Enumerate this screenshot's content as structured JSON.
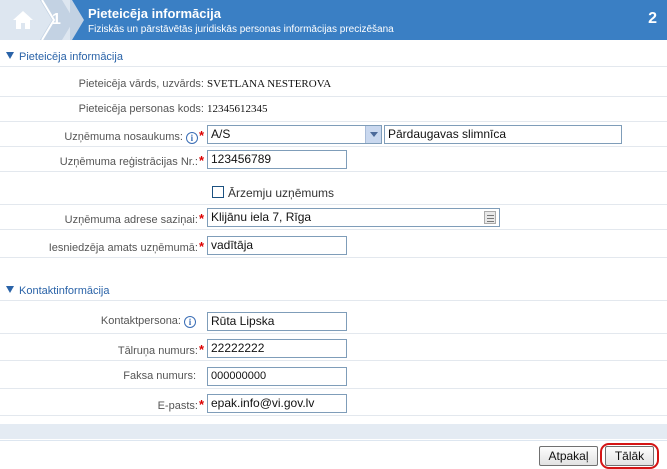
{
  "wizard": {
    "step_prev": "1",
    "title": "Pieteicēja informācija",
    "subtitle": "Fiziskās un pārstāvētās juridiskās personas informācijas precizēšana",
    "step_current": "2"
  },
  "applicant_section": {
    "heading": "Pieteicēja informācija",
    "name_label": "Pieteicēja vārds, uzvārds:",
    "name_value": "SVETLANA NESTEROVA",
    "code_label": "Pieteicēja personas kods:",
    "code_value": "12345612345",
    "company_name_label": "Uzņēmuma nosaukums:",
    "company_type_value": "A/S",
    "company_name_value": "Pārdaugavas slimnīca",
    "reg_no_label": "Uzņēmuma reģistrācijas Nr.:",
    "reg_no_value": "123456789",
    "foreign_label": "Ārzemju uzņēmums",
    "address_label": "Uzņēmuma adrese saziņai:",
    "address_value": "Klijānu iela 7, Rīga",
    "position_label": "Iesniedzēja amats uzņēmumā:",
    "position_value": "vadītāja"
  },
  "contact_section": {
    "heading": "Kontaktinformācija",
    "person_label": "Kontaktpersona:",
    "person_value": "Rūta Lipska",
    "phone_label": "Tālruņa numurs:",
    "phone_value": "22222222",
    "fax_label": "Faksa numurs:",
    "fax_value": "000000000",
    "email_label": "E-pasts:",
    "email_value": "epak.info@vi.gov.lv"
  },
  "buttons": {
    "back": "Atpakaļ",
    "next": "Tālāk"
  },
  "colors": {
    "accent": "#3a7fc4",
    "required": "#dd0000",
    "highlight_ring": "#d41414"
  },
  "icons": {
    "home": "home-icon",
    "info": "info-icon",
    "address_picker": "address-book-icon"
  }
}
